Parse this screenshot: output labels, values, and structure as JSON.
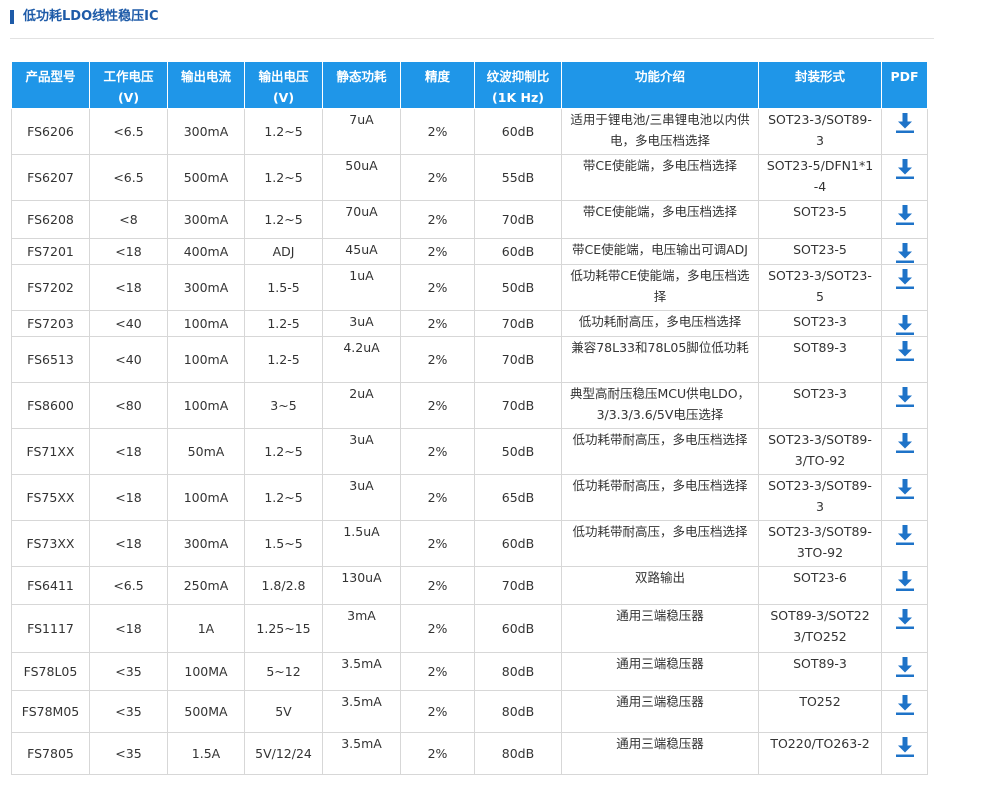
{
  "section": {
    "title": "低功耗LDO线性稳压IC"
  },
  "colors": {
    "accent": "#1e5ba8",
    "header_bg": "#1f96e8",
    "download_icon": "#1e73c8"
  },
  "table": {
    "headers": [
      {
        "line1": "产品型号",
        "line2": ""
      },
      {
        "line1": "工作电压",
        "line2": "(V)"
      },
      {
        "line1": "输出电流",
        "line2": ""
      },
      {
        "line1": "输出电压",
        "line2": "(V)"
      },
      {
        "line1": "静态功耗",
        "line2": ""
      },
      {
        "line1": "精度",
        "line2": ""
      },
      {
        "line1": "纹波抑制比",
        "line2": "(1K Hz)"
      },
      {
        "line1": "功能介绍",
        "line2": ""
      },
      {
        "line1": "封装形式",
        "line2": ""
      },
      {
        "line1": "PDF",
        "line2": ""
      }
    ],
    "rows": [
      {
        "model": "FS6206",
        "voltage": "<6.5",
        "current": "300mA",
        "output": "1.2~5",
        "quiescent": "7uA",
        "accuracy": "2%",
        "psrr": "60dB",
        "function": "适用于锂电池/三串锂电池以内供电，多电压档选择",
        "package": "SOT23-3/SOT89-3",
        "pdf_icon": "download-icon"
      },
      {
        "model": "FS6207",
        "voltage": "<6.5",
        "current": "500mA",
        "output": "1.2~5",
        "quiescent": "50uA",
        "accuracy": "2%",
        "psrr": "55dB",
        "function": "带CE使能端，多电压档选择",
        "package": "SOT23-5/DFN1*1-4",
        "pdf_icon": "download-icon"
      },
      {
        "model": "FS6208",
        "voltage": "<8",
        "current": "300mA",
        "output": "1.2~5",
        "quiescent": "70uA",
        "accuracy": "2%",
        "psrr": "70dB",
        "function": "带CE使能端，多电压档选择",
        "package": "SOT23-5",
        "pdf_icon": "download-icon"
      },
      {
        "model": "FS7201",
        "voltage": "<18",
        "current": "400mA",
        "output": "ADJ",
        "quiescent": "45uA",
        "accuracy": "2%",
        "psrr": "60dB",
        "function": "带CE使能端，电压输出可调ADJ",
        "package": "SOT23-5",
        "pdf_icon": "download-icon"
      },
      {
        "model": "FS7202",
        "voltage": "<18",
        "current": "300mA",
        "output": "1.5-5",
        "quiescent": "1uA",
        "accuracy": "2%",
        "psrr": "50dB",
        "function": "低功耗带CE使能端，多电压档选择",
        "package": "SOT23-3/SOT23-5",
        "pdf_icon": "download-icon"
      },
      {
        "model": "FS7203",
        "voltage": "<40",
        "current": "100mA",
        "output": "1.2-5",
        "quiescent": "3uA",
        "accuracy": "2%",
        "psrr": "70dB",
        "function": "低功耗耐高压，多电压档选择",
        "package": "SOT23-3",
        "pdf_icon": "download-icon"
      },
      {
        "model": "FS6513",
        "voltage": "<40",
        "current": "100mA",
        "output": "1.2-5",
        "quiescent": "4.2uA",
        "accuracy": "2%",
        "psrr": "70dB",
        "function": "兼容78L33和78L05脚位低功耗",
        "package": "SOT89-3",
        "pdf_icon": "download-icon"
      },
      {
        "model": "FS8600",
        "voltage": "<80",
        "current": "100mA",
        "output": "3~5",
        "quiescent": "2uA",
        "accuracy": "2%",
        "psrr": "70dB",
        "function": "典型高耐压稳压MCU供电LDO，3/3.3/3.6/5V电压选择",
        "package": "SOT23-3",
        "pdf_icon": "download-icon"
      },
      {
        "model": "FS71XX",
        "voltage": "<18",
        "current": "50mA",
        "output": "1.2~5",
        "quiescent": "3uA",
        "accuracy": "2%",
        "psrr": "50dB",
        "function": "低功耗带耐高压，多电压档选择",
        "package": "SOT23-3/SOT89-3/TO-92",
        "pdf_icon": "download-icon"
      },
      {
        "model": "FS75XX",
        "voltage": "<18",
        "current": "100mA",
        "output": "1.2~5",
        "quiescent": "3uA",
        "accuracy": "2%",
        "psrr": "65dB",
        "function": "低功耗带耐高压，多电压档选择",
        "package": "SOT23-3/SOT89-3",
        "pdf_icon": "download-icon"
      },
      {
        "model": "FS73XX",
        "voltage": "<18",
        "current": "300mA",
        "output": "1.5~5",
        "quiescent": "1.5uA",
        "accuracy": "2%",
        "psrr": "60dB",
        "function": "低功耗带耐高压，多电压档选择",
        "package": "SOT23-3/SOT89-3TO-92",
        "pdf_icon": "download-icon"
      },
      {
        "model": "FS6411",
        "voltage": "<6.5",
        "current": "250mA",
        "output": "1.8/2.8",
        "quiescent": "130uA",
        "accuracy": "2%",
        "psrr": "70dB",
        "function": "双路输出",
        "package": "SOT23-6",
        "pdf_icon": "download-icon"
      },
      {
        "model": "FS1117",
        "voltage": "<18",
        "current": "1A",
        "output": "1.25~15",
        "quiescent": "3mA",
        "accuracy": "2%",
        "psrr": "60dB",
        "function": "通用三端稳压器",
        "package": "SOT89-3/SOT223/TO252",
        "pdf_icon": "download-icon"
      },
      {
        "model": "FS78L05",
        "voltage": "<35",
        "current": "100MA",
        "output": "5~12",
        "quiescent": "3.5mA",
        "accuracy": "2%",
        "psrr": "80dB",
        "function": "通用三端稳压器",
        "package": "SOT89-3",
        "pdf_icon": "download-icon"
      },
      {
        "model": "FS78M05",
        "voltage": "<35",
        "current": "500MA",
        "output": "5V",
        "quiescent": "3.5mA",
        "accuracy": "2%",
        "psrr": "80dB",
        "function": "通用三端稳压器",
        "package": "TO252",
        "pdf_icon": "download-icon"
      },
      {
        "model": "FS7805",
        "voltage": "<35",
        "current": "1.5A",
        "output": "5V/12/24",
        "quiescent": "3.5mA",
        "accuracy": "2%",
        "psrr": "80dB",
        "function": "通用三端稳压器",
        "package": "TO220/TO263-2",
        "pdf_icon": "download-icon"
      }
    ]
  }
}
